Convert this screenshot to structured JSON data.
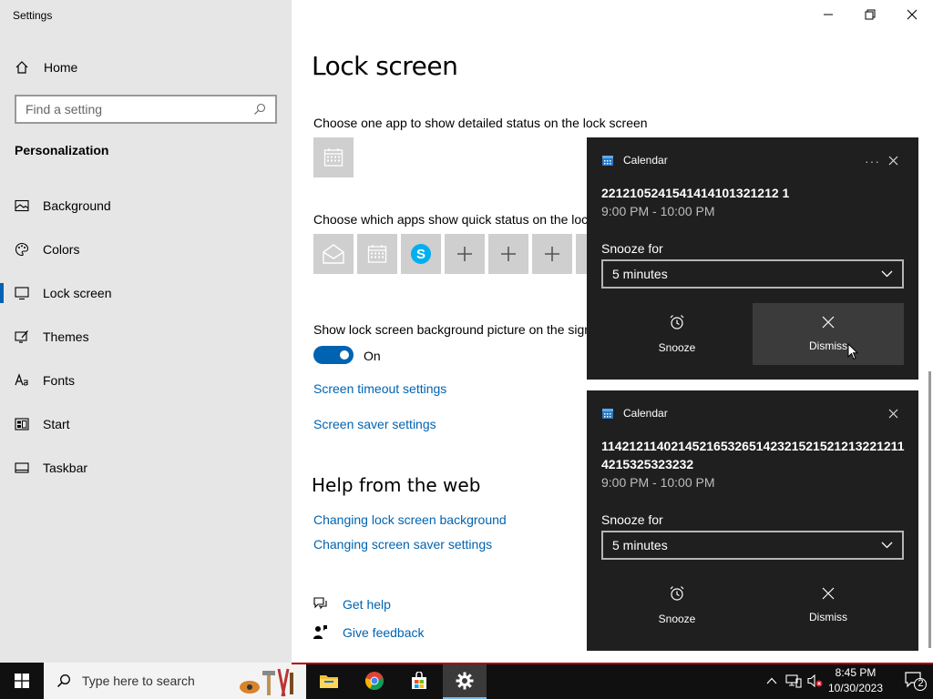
{
  "window": {
    "app_title": "Settings"
  },
  "sidebar": {
    "home_label": "Home",
    "search_placeholder": "Find a setting",
    "section": "Personalization",
    "items": [
      {
        "label": "Background",
        "icon": "picture-icon"
      },
      {
        "label": "Colors",
        "icon": "palette-icon"
      },
      {
        "label": "Lock screen",
        "icon": "lock-screen-icon",
        "active": true
      },
      {
        "label": "Themes",
        "icon": "themes-icon"
      },
      {
        "label": "Fonts",
        "icon": "fonts-icon"
      },
      {
        "label": "Start",
        "icon": "start-icon"
      },
      {
        "label": "Taskbar",
        "icon": "taskbar-icon"
      }
    ]
  },
  "main": {
    "title": "Lock screen",
    "detailed_status_label": "Choose one app to show detailed status on the lock screen",
    "quick_status_label": "Choose which apps show quick status on the lock screen",
    "background_on_signin_label": "Show lock screen background picture on the sign-in screen",
    "toggle_state": "On",
    "link_timeout": "Screen timeout settings",
    "link_screensaver": "Screen saver settings",
    "help_title": "Help from the web",
    "help_link_1": "Changing lock screen background",
    "help_link_2": "Changing screen saver settings",
    "get_help": "Get help",
    "give_feedback": "Give feedback"
  },
  "toasts": [
    {
      "app": "Calendar",
      "title": "2212105241541414101321212 1",
      "time": "9:00 PM - 10:00 PM",
      "snooze_label": "Snooze for",
      "snooze_value": "5 minutes",
      "snooze_button": "Snooze",
      "dismiss_button": "Dismiss"
    },
    {
      "app": "Calendar",
      "title": "11421211402145216532651423215215212132212114215325323232",
      "time": "9:00 PM - 10:00 PM",
      "snooze_label": "Snooze for",
      "snooze_value": "5 minutes",
      "snooze_button": "Snooze",
      "dismiss_button": "Dismiss"
    }
  ],
  "taskbar": {
    "search_placeholder": "Type here to search",
    "time": "8:45 PM",
    "date": "10/30/2023",
    "notification_count": "2"
  },
  "colors": {
    "accent": "#0063b1",
    "sidebar_bg": "#e6e6e6",
    "toast_bg": "#1f1f1f",
    "taskbar_bg": "#101010"
  }
}
